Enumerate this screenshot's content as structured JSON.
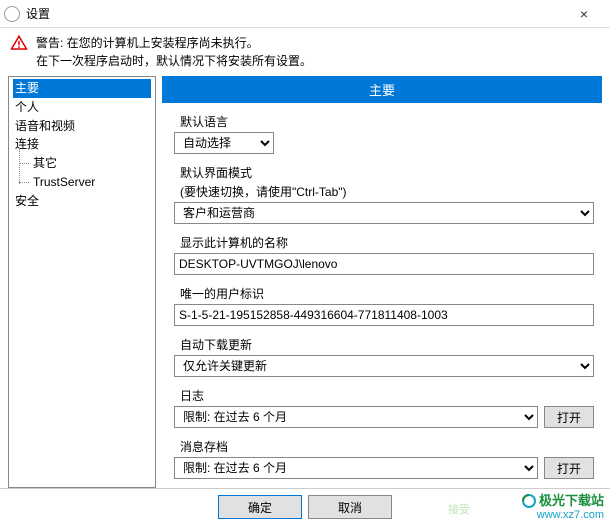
{
  "window": {
    "title": "设置",
    "close": "×"
  },
  "warning": {
    "line1": "警告: 在您的计算机上安装程序尚未执行。",
    "line2": "在下一次程序启动时，默认情况下将安装所有设置。"
  },
  "sidebar": {
    "items": [
      {
        "label": "主要",
        "selected": true
      },
      {
        "label": "个人"
      },
      {
        "label": "语音和视频"
      },
      {
        "label": "连接",
        "children": [
          {
            "label": "其它"
          },
          {
            "label": "TrustServer"
          }
        ]
      },
      {
        "label": "安全"
      }
    ]
  },
  "main": {
    "header": "主要",
    "default_language": {
      "label": "默认语言",
      "value": "自动选择"
    },
    "ui_mode": {
      "label": "默认界面模式",
      "hint": "(要快速切换，请使用\"Ctrl-Tab\")",
      "value": "客户和运营商"
    },
    "computer_name": {
      "label": "显示此计算机的名称",
      "value": "DESKTOP-UVTMGOJ\\lenovo"
    },
    "user_id": {
      "label": "唯一的用户标识",
      "value": "S-1-5-21-195152858-449316604-771811408-1003"
    },
    "auto_update": {
      "label": "自动下载更新",
      "value": "仅允许关键更新"
    },
    "journal": {
      "label": "日志",
      "value": "限制: 在过去 6 个月",
      "open": "打开"
    },
    "archive": {
      "label": "消息存档",
      "value": "限制: 在过去 6 个月",
      "open": "打开"
    }
  },
  "footer": {
    "ok": "确定",
    "cancel": "取消",
    "accept_hint": "接受"
  },
  "watermark": {
    "brand": "极光下载站",
    "url": "www.xz7.com"
  }
}
